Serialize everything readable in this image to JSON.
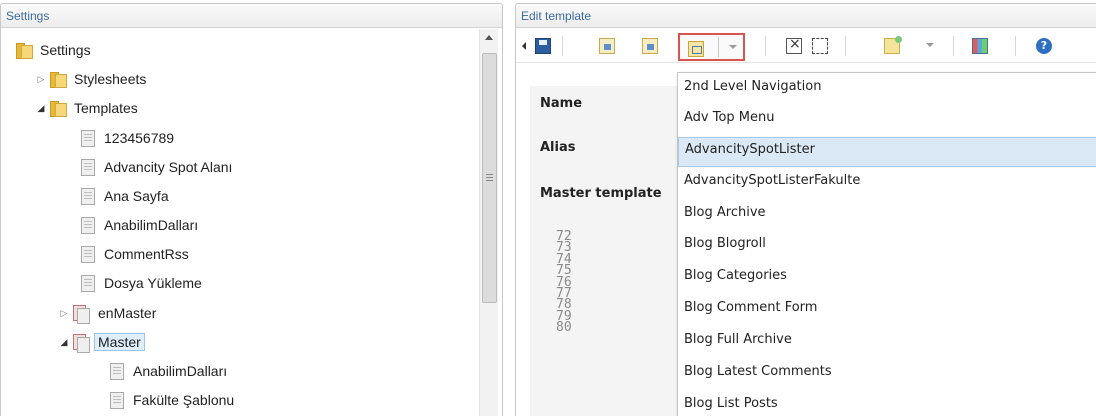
{
  "settings_panel": {
    "title": "Settings",
    "tree": [
      {
        "label": "Settings"
      },
      {
        "label": "Stylesheets"
      },
      {
        "label": "Templates"
      },
      {
        "label": "123456789"
      },
      {
        "label": "Advancity Spot Alanı"
      },
      {
        "label": "Ana Sayfa"
      },
      {
        "label": "AnabilimDalları"
      },
      {
        "label": "CommentRss"
      },
      {
        "label": "Dosya Yükleme"
      },
      {
        "label": "enMaster"
      },
      {
        "label": "Master"
      },
      {
        "label": "AnabilimDalları"
      },
      {
        "label": "Fakülte Şablonu"
      }
    ]
  },
  "edit_panel": {
    "title": "Edit template",
    "form": {
      "name_label": "Name",
      "alias_label": "Alias",
      "master_label": "Master template"
    },
    "line_numbers": [
      "72",
      "73",
      "74",
      "75",
      "76",
      "77",
      "78",
      "79",
      "80"
    ]
  },
  "macro_dropdown": {
    "items": [
      {
        "label": "2nd Level Navigation"
      },
      {
        "label": "Adv Top Menu"
      },
      {
        "label": "AdvancitySpotLister"
      },
      {
        "label": "AdvancitySpotListerFakulte"
      },
      {
        "label": "Blog Archive"
      },
      {
        "label": "Blog Blogroll"
      },
      {
        "label": "Blog Categories"
      },
      {
        "label": "Blog Comment Form"
      },
      {
        "label": "Blog Full Archive"
      },
      {
        "label": "Blog Latest Comments"
      },
      {
        "label": "Blog List Posts"
      }
    ]
  },
  "icons": {
    "save": "save-icon",
    "insert_field": "insert-field-icon",
    "insert_content_area": "insert-content-area-icon",
    "insert_macro": "insert-macro-icon",
    "help": "help-icon"
  },
  "colors": {
    "header_text": "#3c6b9a",
    "highlight_border": "#d9534f",
    "selection": "#dbe9f6"
  }
}
